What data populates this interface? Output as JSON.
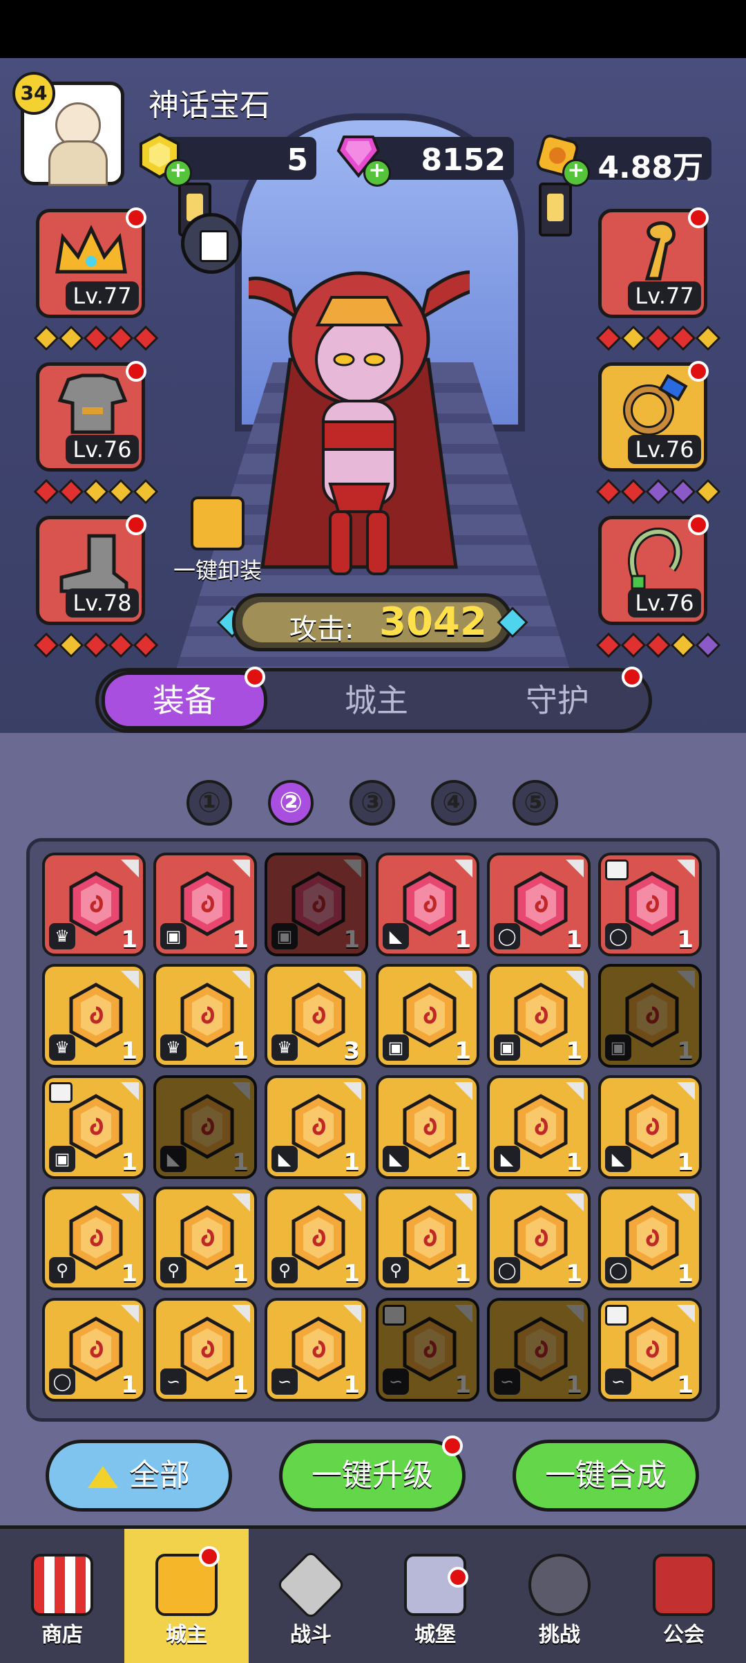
{
  "header": {
    "player_level": "34",
    "title": "神话宝石",
    "currencies": [
      {
        "icon": "yellow-gem-icon",
        "value": "5"
      },
      {
        "icon": "pink-crystal-icon",
        "value": "8152"
      },
      {
        "icon": "gold-coin-icon",
        "value": "4.88万"
      }
    ]
  },
  "equipment": {
    "left": [
      {
        "icon": "crown-icon",
        "level": "Lv.77",
        "diamonds": [
          "y",
          "y",
          "r",
          "r",
          "r"
        ]
      },
      {
        "icon": "armor-icon",
        "level": "Lv.76",
        "diamonds": [
          "r",
          "r",
          "y",
          "y",
          "y"
        ]
      },
      {
        "icon": "boot-icon",
        "level": "Lv.78",
        "diamonds": [
          "r",
          "y",
          "r",
          "r",
          "r"
        ]
      }
    ],
    "right": [
      {
        "icon": "staff-icon",
        "level": "Lv.77",
        "diamonds": [
          "r",
          "y",
          "r",
          "r",
          "y"
        ]
      },
      {
        "icon": "ring-icon",
        "level": "Lv.76",
        "diamonds": [
          "r",
          "r",
          "p",
          "p",
          "y"
        ]
      },
      {
        "icon": "necklace-icon",
        "level": "Lv.76",
        "diamonds": [
          "r",
          "r",
          "r",
          "y",
          "p"
        ]
      }
    ]
  },
  "unequip_label": "一键卸装",
  "attack": {
    "label": "攻击:",
    "value": "3042"
  },
  "tabs": [
    "装备",
    "城主",
    "守护"
  ],
  "pages": [
    "①",
    "②",
    "③",
    "④",
    "⑤"
  ],
  "active_page": 1,
  "gems": [
    {
      "color": "red",
      "type": "crown",
      "count": "1"
    },
    {
      "color": "red",
      "type": "armor",
      "count": "1"
    },
    {
      "color": "red",
      "type": "armor",
      "count": "1",
      "dim": true
    },
    {
      "color": "red",
      "type": "boot",
      "count": "1"
    },
    {
      "color": "red",
      "type": "ring",
      "count": "1"
    },
    {
      "color": "red",
      "type": "ring",
      "count": "1",
      "lock": true
    },
    {
      "color": "gold",
      "type": "crown",
      "count": "1"
    },
    {
      "color": "gold",
      "type": "crown",
      "count": "1"
    },
    {
      "color": "gold",
      "type": "crown",
      "count": "3"
    },
    {
      "color": "gold",
      "type": "armor",
      "count": "1"
    },
    {
      "color": "gold",
      "type": "armor",
      "count": "1"
    },
    {
      "color": "gold",
      "type": "armor",
      "count": "1",
      "dim": true
    },
    {
      "color": "gold",
      "type": "armor",
      "count": "1",
      "lock": true
    },
    {
      "color": "gold",
      "type": "boot",
      "count": "1",
      "dim": true
    },
    {
      "color": "gold",
      "type": "boot",
      "count": "1"
    },
    {
      "color": "gold",
      "type": "boot",
      "count": "1"
    },
    {
      "color": "gold",
      "type": "boot",
      "count": "1"
    },
    {
      "color": "gold",
      "type": "boot",
      "count": "1"
    },
    {
      "color": "gold",
      "type": "staff",
      "count": "1"
    },
    {
      "color": "gold",
      "type": "staff",
      "count": "1"
    },
    {
      "color": "gold",
      "type": "staff",
      "count": "1"
    },
    {
      "color": "gold",
      "type": "staff",
      "count": "1"
    },
    {
      "color": "gold",
      "type": "ring",
      "count": "1"
    },
    {
      "color": "gold",
      "type": "ring",
      "count": "1"
    },
    {
      "color": "gold",
      "type": "ring",
      "count": "1"
    },
    {
      "color": "gold",
      "type": "necklace",
      "count": "1"
    },
    {
      "color": "gold",
      "type": "necklace",
      "count": "1"
    },
    {
      "color": "gold",
      "type": "necklace",
      "count": "1",
      "dim": true,
      "lock": true
    },
    {
      "color": "gold",
      "type": "necklace",
      "count": "1",
      "dim": true
    },
    {
      "color": "gold",
      "type": "necklace",
      "count": "1",
      "lock": true
    }
  ],
  "bottom_buttons": {
    "all": "全部",
    "upgrade": "一键升级",
    "combine": "一键合成"
  },
  "nav": [
    {
      "label": "商店",
      "icon": "shop-icon"
    },
    {
      "label": "城主",
      "icon": "crown-icon"
    },
    {
      "label": "战斗",
      "icon": "swords-icon"
    },
    {
      "label": "城堡",
      "icon": "castle-icon"
    },
    {
      "label": "挑战",
      "icon": "demon-icon"
    },
    {
      "label": "公会",
      "icon": "banner-icon"
    }
  ]
}
